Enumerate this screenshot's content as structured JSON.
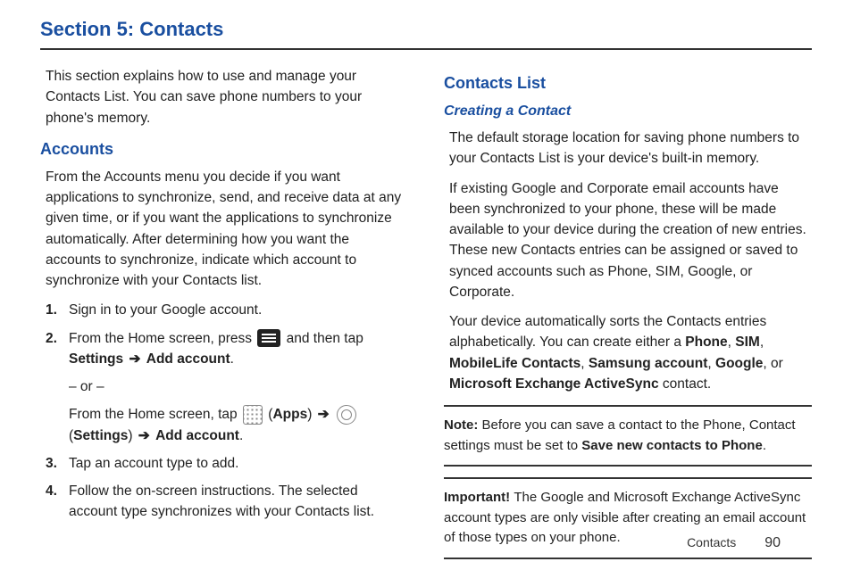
{
  "title": "Section 5: Contacts",
  "col1": {
    "intro": "This section explains how to use and manage your Contacts List. You can save phone numbers to your phone's memory.",
    "accounts_heading": "Accounts",
    "accounts_text": "From the Accounts menu you decide if you want applications to synchronize, send, and receive data at any given time, or if you want the applications to synchronize automatically. After determining how you want the accounts to synchronize, indicate which account to synchronize with your Contacts list.",
    "step1_num": "1.",
    "step1_text": "Sign in to your Google account.",
    "step2_num": "2.",
    "step2_pre": "From the Home screen, press ",
    "step2_post": " and then tap ",
    "step2_settings": "Settings",
    "step2_arrow": " ➔ ",
    "step2_add": "Add account",
    "step2_period": ".",
    "step2_or": "– or –",
    "step2_alt_pre": "From the Home screen, tap ",
    "step2_alt_apps": " (",
    "step2_alt_apps_b": "Apps",
    "step2_alt_apps_c": ") ",
    "step2_alt_set_a": " (",
    "step2_alt_set_b": "Settings",
    "step2_alt_set_c": ") ",
    "step2_alt_add": " Add account",
    "step3_num": "3.",
    "step3_text": "Tap an account type to add.",
    "step4_num": "4.",
    "step4_text": "Follow the on-screen instructions. The selected account type synchronizes with your Contacts list."
  },
  "col2": {
    "contacts_list_heading": "Contacts List",
    "creating_heading": "Creating a Contact",
    "p1": "The default storage location for saving phone numbers to your Contacts List is your device's built-in memory.",
    "p2": "If existing Google and Corporate email accounts have been synchronized to your phone, these will be made available to your device during the creation of new entries. These new Contacts entries can be assigned or saved to synced accounts such as Phone, SIM, Google, or Corporate.",
    "p3_a": "Your device automatically sorts the Contacts entries alphabetically. You can create either a ",
    "p3_phone": "Phone",
    "p3_c1": ", ",
    "p3_sim": "SIM",
    "p3_c2": ", ",
    "p3_ml": "MobileLife Contacts",
    "p3_c3": ", ",
    "p3_sam": "Samsung account",
    "p3_c4": ", ",
    "p3_goog": "Google",
    "p3_c5": ", or ",
    "p3_ms": "Microsoft Exchange ActiveSync",
    "p3_end": " contact.",
    "note_label": "Note: ",
    "note_text_a": "Before you can save a contact to the Phone, Contact settings must be set to ",
    "note_bold": "Save new contacts to Phone",
    "note_text_b": ".",
    "important_label": "Important! ",
    "important_text": "The Google and Microsoft Exchange ActiveSync account types are only visible after creating an email account of those types on your phone."
  },
  "footer": {
    "section": "Contacts",
    "page": "90"
  }
}
